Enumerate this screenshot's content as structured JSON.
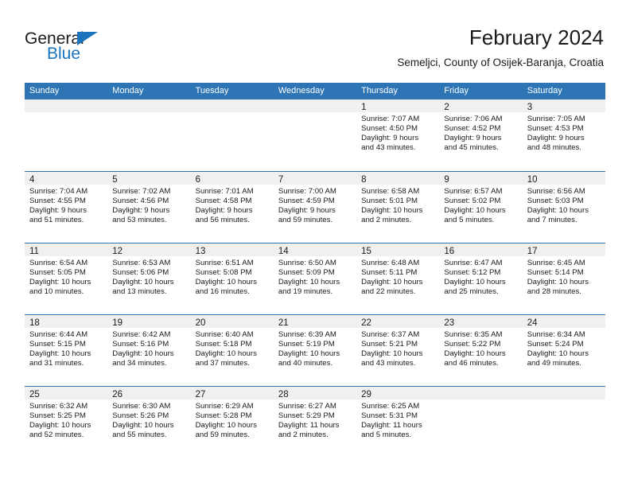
{
  "brand": {
    "name_top": "General",
    "name_bottom": "Blue",
    "triangle_color": "#1b74bb"
  },
  "header": {
    "title": "February 2024",
    "subtitle": "Semeljci, County of Osijek-Baranja, Croatia"
  },
  "colors": {
    "header_blue": "#2e75b6",
    "daynum_band": "#f0f0f0",
    "text": "#1a1a1a"
  },
  "calendar": {
    "weekdays": [
      "Sunday",
      "Monday",
      "Tuesday",
      "Wednesday",
      "Thursday",
      "Friday",
      "Saturday"
    ],
    "weeks": [
      [
        {
          "day": "",
          "sunrise": "",
          "sunset": "",
          "daylight_1": "",
          "daylight_2": ""
        },
        {
          "day": "",
          "sunrise": "",
          "sunset": "",
          "daylight_1": "",
          "daylight_2": ""
        },
        {
          "day": "",
          "sunrise": "",
          "sunset": "",
          "daylight_1": "",
          "daylight_2": ""
        },
        {
          "day": "",
          "sunrise": "",
          "sunset": "",
          "daylight_1": "",
          "daylight_2": ""
        },
        {
          "day": "1",
          "sunrise": "Sunrise: 7:07 AM",
          "sunset": "Sunset: 4:50 PM",
          "daylight_1": "Daylight: 9 hours",
          "daylight_2": "and 43 minutes."
        },
        {
          "day": "2",
          "sunrise": "Sunrise: 7:06 AM",
          "sunset": "Sunset: 4:52 PM",
          "daylight_1": "Daylight: 9 hours",
          "daylight_2": "and 45 minutes."
        },
        {
          "day": "3",
          "sunrise": "Sunrise: 7:05 AM",
          "sunset": "Sunset: 4:53 PM",
          "daylight_1": "Daylight: 9 hours",
          "daylight_2": "and 48 minutes."
        }
      ],
      [
        {
          "day": "4",
          "sunrise": "Sunrise: 7:04 AM",
          "sunset": "Sunset: 4:55 PM",
          "daylight_1": "Daylight: 9 hours",
          "daylight_2": "and 51 minutes."
        },
        {
          "day": "5",
          "sunrise": "Sunrise: 7:02 AM",
          "sunset": "Sunset: 4:56 PM",
          "daylight_1": "Daylight: 9 hours",
          "daylight_2": "and 53 minutes."
        },
        {
          "day": "6",
          "sunrise": "Sunrise: 7:01 AM",
          "sunset": "Sunset: 4:58 PM",
          "daylight_1": "Daylight: 9 hours",
          "daylight_2": "and 56 minutes."
        },
        {
          "day": "7",
          "sunrise": "Sunrise: 7:00 AM",
          "sunset": "Sunset: 4:59 PM",
          "daylight_1": "Daylight: 9 hours",
          "daylight_2": "and 59 minutes."
        },
        {
          "day": "8",
          "sunrise": "Sunrise: 6:58 AM",
          "sunset": "Sunset: 5:01 PM",
          "daylight_1": "Daylight: 10 hours",
          "daylight_2": "and 2 minutes."
        },
        {
          "day": "9",
          "sunrise": "Sunrise: 6:57 AM",
          "sunset": "Sunset: 5:02 PM",
          "daylight_1": "Daylight: 10 hours",
          "daylight_2": "and 5 minutes."
        },
        {
          "day": "10",
          "sunrise": "Sunrise: 6:56 AM",
          "sunset": "Sunset: 5:03 PM",
          "daylight_1": "Daylight: 10 hours",
          "daylight_2": "and 7 minutes."
        }
      ],
      [
        {
          "day": "11",
          "sunrise": "Sunrise: 6:54 AM",
          "sunset": "Sunset: 5:05 PM",
          "daylight_1": "Daylight: 10 hours",
          "daylight_2": "and 10 minutes."
        },
        {
          "day": "12",
          "sunrise": "Sunrise: 6:53 AM",
          "sunset": "Sunset: 5:06 PM",
          "daylight_1": "Daylight: 10 hours",
          "daylight_2": "and 13 minutes."
        },
        {
          "day": "13",
          "sunrise": "Sunrise: 6:51 AM",
          "sunset": "Sunset: 5:08 PM",
          "daylight_1": "Daylight: 10 hours",
          "daylight_2": "and 16 minutes."
        },
        {
          "day": "14",
          "sunrise": "Sunrise: 6:50 AM",
          "sunset": "Sunset: 5:09 PM",
          "daylight_1": "Daylight: 10 hours",
          "daylight_2": "and 19 minutes."
        },
        {
          "day": "15",
          "sunrise": "Sunrise: 6:48 AM",
          "sunset": "Sunset: 5:11 PM",
          "daylight_1": "Daylight: 10 hours",
          "daylight_2": "and 22 minutes."
        },
        {
          "day": "16",
          "sunrise": "Sunrise: 6:47 AM",
          "sunset": "Sunset: 5:12 PM",
          "daylight_1": "Daylight: 10 hours",
          "daylight_2": "and 25 minutes."
        },
        {
          "day": "17",
          "sunrise": "Sunrise: 6:45 AM",
          "sunset": "Sunset: 5:14 PM",
          "daylight_1": "Daylight: 10 hours",
          "daylight_2": "and 28 minutes."
        }
      ],
      [
        {
          "day": "18",
          "sunrise": "Sunrise: 6:44 AM",
          "sunset": "Sunset: 5:15 PM",
          "daylight_1": "Daylight: 10 hours",
          "daylight_2": "and 31 minutes."
        },
        {
          "day": "19",
          "sunrise": "Sunrise: 6:42 AM",
          "sunset": "Sunset: 5:16 PM",
          "daylight_1": "Daylight: 10 hours",
          "daylight_2": "and 34 minutes."
        },
        {
          "day": "20",
          "sunrise": "Sunrise: 6:40 AM",
          "sunset": "Sunset: 5:18 PM",
          "daylight_1": "Daylight: 10 hours",
          "daylight_2": "and 37 minutes."
        },
        {
          "day": "21",
          "sunrise": "Sunrise: 6:39 AM",
          "sunset": "Sunset: 5:19 PM",
          "daylight_1": "Daylight: 10 hours",
          "daylight_2": "and 40 minutes."
        },
        {
          "day": "22",
          "sunrise": "Sunrise: 6:37 AM",
          "sunset": "Sunset: 5:21 PM",
          "daylight_1": "Daylight: 10 hours",
          "daylight_2": "and 43 minutes."
        },
        {
          "day": "23",
          "sunrise": "Sunrise: 6:35 AM",
          "sunset": "Sunset: 5:22 PM",
          "daylight_1": "Daylight: 10 hours",
          "daylight_2": "and 46 minutes."
        },
        {
          "day": "24",
          "sunrise": "Sunrise: 6:34 AM",
          "sunset": "Sunset: 5:24 PM",
          "daylight_1": "Daylight: 10 hours",
          "daylight_2": "and 49 minutes."
        }
      ],
      [
        {
          "day": "25",
          "sunrise": "Sunrise: 6:32 AM",
          "sunset": "Sunset: 5:25 PM",
          "daylight_1": "Daylight: 10 hours",
          "daylight_2": "and 52 minutes."
        },
        {
          "day": "26",
          "sunrise": "Sunrise: 6:30 AM",
          "sunset": "Sunset: 5:26 PM",
          "daylight_1": "Daylight: 10 hours",
          "daylight_2": "and 55 minutes."
        },
        {
          "day": "27",
          "sunrise": "Sunrise: 6:29 AM",
          "sunset": "Sunset: 5:28 PM",
          "daylight_1": "Daylight: 10 hours",
          "daylight_2": "and 59 minutes."
        },
        {
          "day": "28",
          "sunrise": "Sunrise: 6:27 AM",
          "sunset": "Sunset: 5:29 PM",
          "daylight_1": "Daylight: 11 hours",
          "daylight_2": "and 2 minutes."
        },
        {
          "day": "29",
          "sunrise": "Sunrise: 6:25 AM",
          "sunset": "Sunset: 5:31 PM",
          "daylight_1": "Daylight: 11 hours",
          "daylight_2": "and 5 minutes."
        },
        {
          "day": "",
          "sunrise": "",
          "sunset": "",
          "daylight_1": "",
          "daylight_2": ""
        },
        {
          "day": "",
          "sunrise": "",
          "sunset": "",
          "daylight_1": "",
          "daylight_2": ""
        }
      ]
    ]
  }
}
